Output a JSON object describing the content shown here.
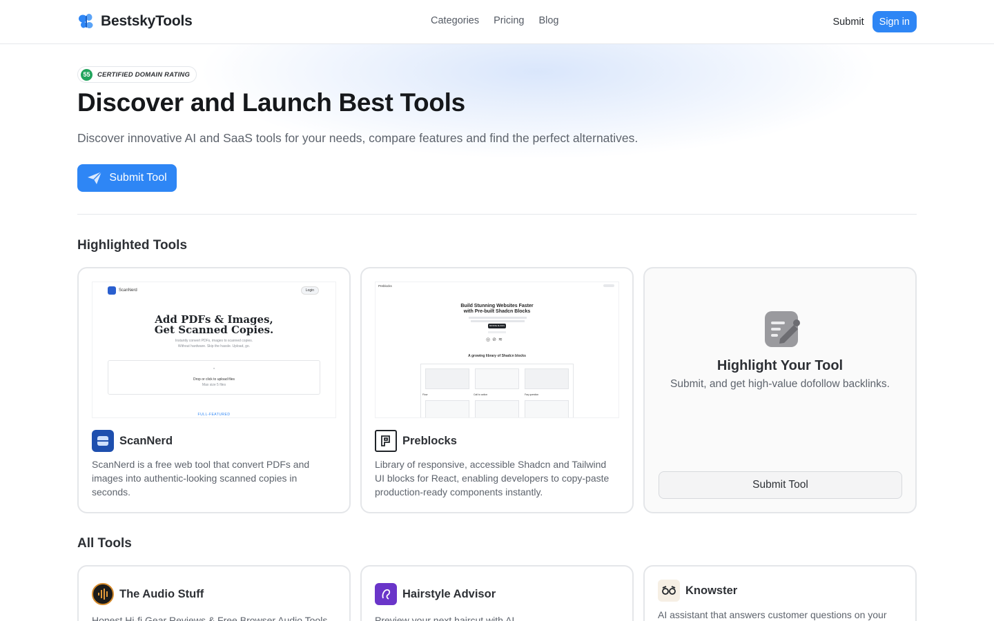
{
  "header": {
    "logo_text": "BestskyTools",
    "nav": [
      "Categories",
      "Pricing",
      "Blog"
    ],
    "submit_label": "Submit",
    "signin_label": "Sign in"
  },
  "hero": {
    "badge_number": "55",
    "badge_text": "CERTIFIED DOMAIN RATING",
    "title": "Discover and Launch Best Tools",
    "subtitle": "Discover innovative AI and SaaS tools for your needs, compare features and find the perfect alternatives.",
    "cta_label": "Submit Tool"
  },
  "highlighted": {
    "section_title": "Highlighted Tools",
    "tools": [
      {
        "name": "ScanNerd",
        "description": "ScanNerd is a free web tool that convert PDFs and images into authentic-looking scanned copies in seconds.",
        "shot": {
          "brand": "ScanNerd",
          "login": "Login",
          "headline_1": "Add PDFs & Images,",
          "headline_2": "Get Scanned Copies.",
          "sub_1": "Instantly convert PDFs, images to scanned copies.",
          "sub_2": "Without hardware. Skip the hassle. Upload, go.",
          "drop": "Drop or click to upload files",
          "drop_sub": "Max size 5 files",
          "footer": "FULL-FEATURED"
        }
      },
      {
        "name": "Preblocks",
        "description": "Library of responsive, accessible Shadcn and Tailwind UI blocks for React, enabling developers to copy-paste production-ready components instantly.",
        "shot": {
          "brand": "Preblocks",
          "headline_1": "Build Stunning Websites Faster",
          "headline_2": "with Pre-built Shadcn Blocks",
          "button": "BROWSE BLOCKS",
          "library": "A growing library of Shadcn blocks",
          "col_1": "Flow",
          "col_2": "Call to action",
          "col_3": "Faq question"
        }
      }
    ],
    "promo": {
      "title": "Highlight Your Tool",
      "subtitle": "Submit, and get high-value dofollow backlinks.",
      "button": "Submit Tool"
    }
  },
  "all_tools": {
    "section_title": "All Tools",
    "tools": [
      {
        "name": "The Audio Stuff",
        "description": "Honest Hi-fi Gear Reviews & Free Browser Audio Tools"
      },
      {
        "name": "Hairstyle Advisor",
        "description": "Preview your next haircut with AI"
      },
      {
        "name": "Knowster",
        "description": "AI assistant that answers customer questions on your"
      }
    ]
  },
  "colors": {
    "accent": "#2e86f5",
    "badge_green": "#22a45d",
    "text_dark": "#16181b",
    "text_muted": "#5d636c"
  }
}
